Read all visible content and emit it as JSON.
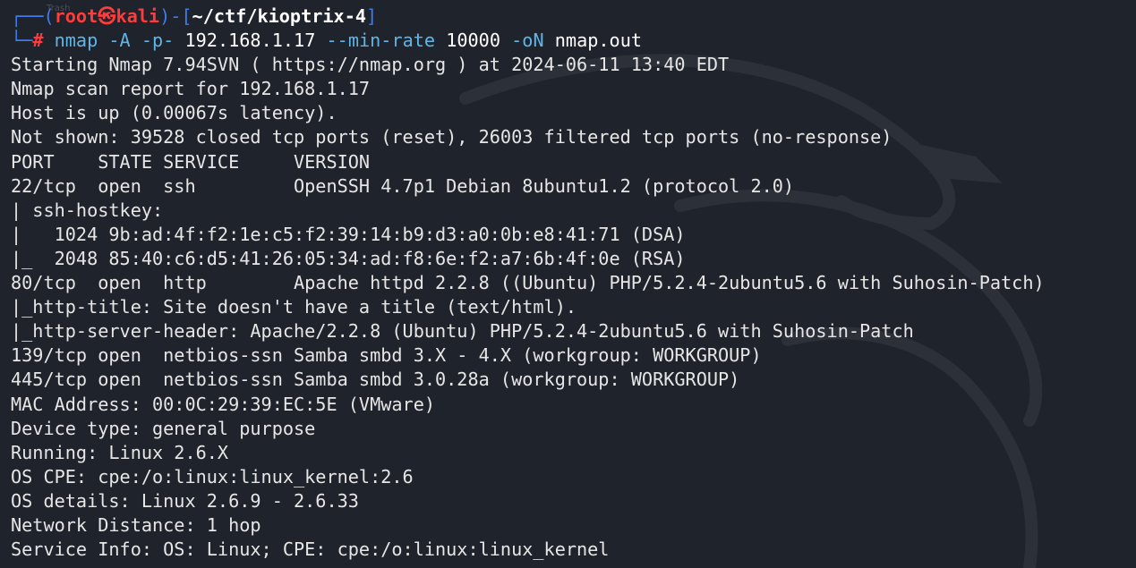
{
  "background_label": "Trash",
  "prompt": {
    "open": "┌──(",
    "user": "root",
    "skull": "㉿",
    "host": "kali",
    "close": ")-[",
    "cwd": "~/ctf/kioptrix-4",
    "end": "]",
    "line2_prefix": "└─",
    "hash": "#"
  },
  "command": {
    "program": "nmap",
    "parts": [
      {
        "text": "-A",
        "kind": "flag"
      },
      {
        "text": "-p-",
        "kind": "flag"
      },
      {
        "text": "192.168.1.17",
        "kind": "arg"
      },
      {
        "text": "--min-rate",
        "kind": "flag"
      },
      {
        "text": "10000",
        "kind": "arg"
      },
      {
        "text": "-oN",
        "kind": "flag"
      },
      {
        "text": "nmap.out",
        "kind": "arg"
      }
    ]
  },
  "output": [
    "Starting Nmap 7.94SVN ( https://nmap.org ) at 2024-06-11 13:40 EDT",
    "Nmap scan report for 192.168.1.17",
    "Host is up (0.00067s latency).",
    "Not shown: 39528 closed tcp ports (reset), 26003 filtered tcp ports (no-response)",
    "PORT    STATE SERVICE     VERSION",
    "22/tcp  open  ssh         OpenSSH 4.7p1 Debian 8ubuntu1.2 (protocol 2.0)",
    "| ssh-hostkey: ",
    "|   1024 9b:ad:4f:f2:1e:c5:f2:39:14:b9:d3:a0:0b:e8:41:71 (DSA)",
    "|_  2048 85:40:c6:d5:41:26:05:34:ad:f8:6e:f2:a7:6b:4f:0e (RSA)",
    "80/tcp  open  http        Apache httpd 2.2.8 ((Ubuntu) PHP/5.2.4-2ubuntu5.6 with Suhosin-Patch)",
    "|_http-title: Site doesn't have a title (text/html).",
    "|_http-server-header: Apache/2.2.8 (Ubuntu) PHP/5.2.4-2ubuntu5.6 with Suhosin-Patch",
    "139/tcp open  netbios-ssn Samba smbd 3.X - 4.X (workgroup: WORKGROUP)",
    "445/tcp open  netbios-ssn Samba smbd 3.0.28a (workgroup: WORKGROUP)",
    "MAC Address: 00:0C:29:39:EC:5E (VMware)",
    "Device type: general purpose",
    "Running: Linux 2.6.X",
    "OS CPE: cpe:/o:linux:linux_kernel:2.6",
    "OS details: Linux 2.6.9 - 2.6.33",
    "Network Distance: 1 hop",
    "Service Info: OS: Linux; CPE: cpe:/o:linux:linux_kernel"
  ],
  "colors": {
    "background": "#1f232b",
    "prompt_frame": "#3d7cf0",
    "prompt_user_host": "#ff3b3b",
    "flag": "#5fb5e8",
    "text": "#e6e6e6"
  }
}
